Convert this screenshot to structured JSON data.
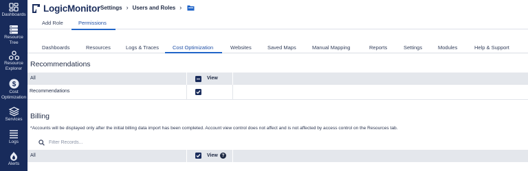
{
  "nav": {
    "items": [
      {
        "label": "Dashboards",
        "icon": "dashboards-icon"
      },
      {
        "label": "Resource Tree",
        "icon": "resource-tree-icon"
      },
      {
        "label": "Resource Explorer",
        "icon": "resource-explorer-icon"
      },
      {
        "label": "Cost Optimization",
        "icon": "cost-optimization-icon"
      },
      {
        "label": "Services",
        "icon": "services-icon"
      },
      {
        "label": "Logs",
        "icon": "logs-icon"
      },
      {
        "label": "Alerts",
        "icon": "alerts-icon"
      }
    ]
  },
  "header": {
    "logo_text": "LogicMonitor",
    "breadcrumb": [
      "Settings",
      "Users and Roles"
    ]
  },
  "top_tabs": [
    "Add Role",
    "Permissions"
  ],
  "active_top_tab": "Permissions",
  "sub_tabs": [
    "Dashboards",
    "Resources",
    "Logs & Traces",
    "Cost Optimization",
    "Websites",
    "Saved Maps",
    "Manual Mapping",
    "Reports",
    "Settings",
    "Modules",
    "Help & Support"
  ],
  "active_sub_tab": "Cost Optimization",
  "recommendations": {
    "title": "Recommendations",
    "header_label": "All",
    "view_label": "View",
    "row_label": "Recommendations",
    "row_view_checked": true
  },
  "billing": {
    "title": "Billing",
    "note": "*Accounts will be displayed only after the initial billing data import has been completed. Account view control does not affect and is not affected by access control on the Resources tab.",
    "filter_placeholder": "Filter Records...",
    "header_label": "All",
    "view_label": "View",
    "help_symbol": "?"
  },
  "colors": {
    "nav_bg": "#182b5b",
    "accent": "#1f64c8",
    "checkbox": "#1b2d5c",
    "grid_header": "#e4e7ec"
  }
}
